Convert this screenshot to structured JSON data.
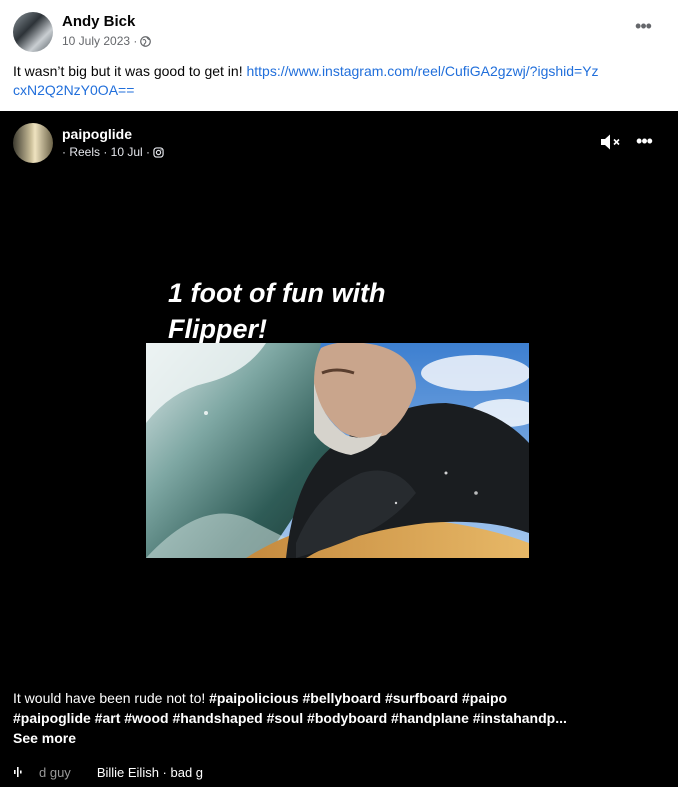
{
  "post": {
    "author": "Andy Bick",
    "date": "10 July 2023 ·",
    "text": "It wasn’t big but it was good to get in! ",
    "link": "https://www.instagram.com/reel/CufiGA2gzwj/?igshid=YzcxN2Q2NzY0OA=="
  },
  "reel": {
    "author": "paipoglide",
    "meta": "· Reels · 10 Jul ·",
    "overlay_line1": "1 foot of fun with",
    "overlay_line2": "Flipper!",
    "caption_plain": "It would have been rude not to! ",
    "caption_tags": "#paipolicious #bellyboard #surfboard #paipo #paipoglide #art #wood #handshaped #soul #bodyboard #handplane #instahandp...",
    "see_more": " See more",
    "audio_fade": "d guy",
    "audio_track": "Billie Eilish · bad g"
  },
  "icons": {
    "globe": "globe-icon",
    "instagram": "instagram-icon",
    "mute": "speaker-muted-icon",
    "more": "more-horizontal-icon",
    "audio": "audio-waveform-icon"
  },
  "colors": {
    "link": "#216fdb",
    "reel_background": "#000000",
    "meta_gray": "#65676b"
  }
}
